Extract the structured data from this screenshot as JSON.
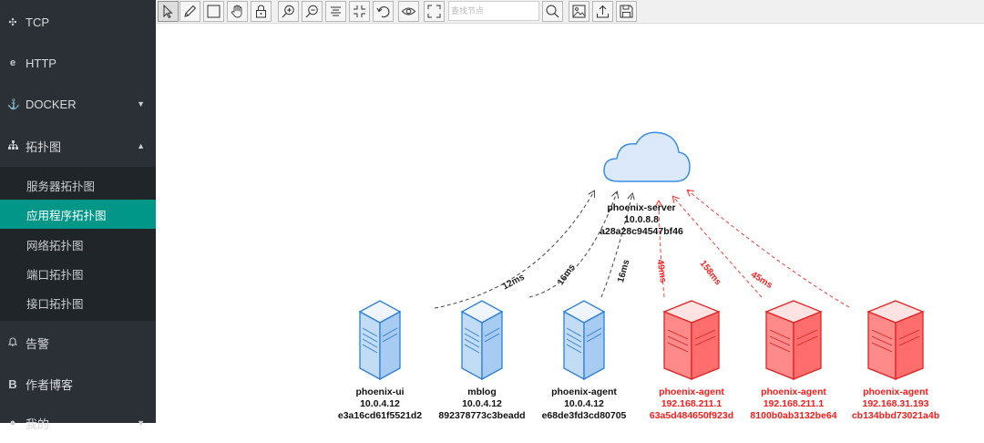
{
  "sidebar": {
    "items": [
      {
        "label": "TCP",
        "icon": "plug-icon"
      },
      {
        "label": "HTTP",
        "icon": "ie-icon"
      },
      {
        "label": "DOCKER",
        "icon": "docker-icon"
      },
      {
        "label": "拓扑图",
        "icon": "sitemap-icon",
        "expanded": true
      }
    ],
    "sub_items": [
      {
        "label": "服务器拓扑图"
      },
      {
        "label": "应用程序拓扑图",
        "active": true
      },
      {
        "label": "网络拓扑图"
      },
      {
        "label": "端口拓扑图"
      },
      {
        "label": "接口拓扑图"
      }
    ],
    "bottom_items": [
      {
        "label": "告警",
        "icon": "bell-icon"
      },
      {
        "label": "作者博客",
        "icon": "b-icon"
      },
      {
        "label": "我的",
        "icon": "user-icon"
      }
    ]
  },
  "toolbar": {
    "search_placeholder": "查找节点",
    "tools": [
      "pointer-icon",
      "pencil-icon",
      "rectangle-icon",
      "hand-icon",
      "lock-icon",
      "zoom-in-icon",
      "zoom-out-icon",
      "align-icon",
      "fit-icon",
      "undo-icon",
      "eye-icon",
      "fullscreen-icon",
      "search-icon",
      "image-icon",
      "upload-icon",
      "save-icon"
    ]
  },
  "colors": {
    "sidebar_bg": "#2b3036",
    "active_item": "#009688",
    "normal_node": "#1e88e5",
    "alert_node": "#ff1a1a",
    "cloud_fill": "#dbe9fb"
  },
  "topology": {
    "server": {
      "name": "phoenix-server",
      "ip": "10.0.8.8",
      "id": "a28a28c94547bf46"
    },
    "nodes": [
      {
        "name": "phoenix-ui",
        "ip": "10.0.4.12",
        "id": "e3a16cd61f5521d2",
        "status": "normal",
        "latency": "12ms"
      },
      {
        "name": "mblog",
        "ip": "10.0.4.12",
        "id": "892378773c3beadd",
        "status": "normal",
        "latency": "16ms"
      },
      {
        "name": "phoenix-agent",
        "ip": "10.0.4.12",
        "id": "e68de3fd3cd80705",
        "status": "normal",
        "latency": "16ms"
      },
      {
        "name": "phoenix-agent",
        "ip": "192.168.211.1",
        "id": "63a5d484650f923d",
        "status": "alert",
        "latency": "49ms"
      },
      {
        "name": "phoenix-agent",
        "ip": "192.168.211.1",
        "id": "8100b0ab3132be64",
        "status": "alert",
        "latency": "158ms"
      },
      {
        "name": "phoenix-agent",
        "ip": "192.168.31.193",
        "id": "cb134bbd73021a4b",
        "status": "alert",
        "latency": "45ms"
      }
    ]
  }
}
